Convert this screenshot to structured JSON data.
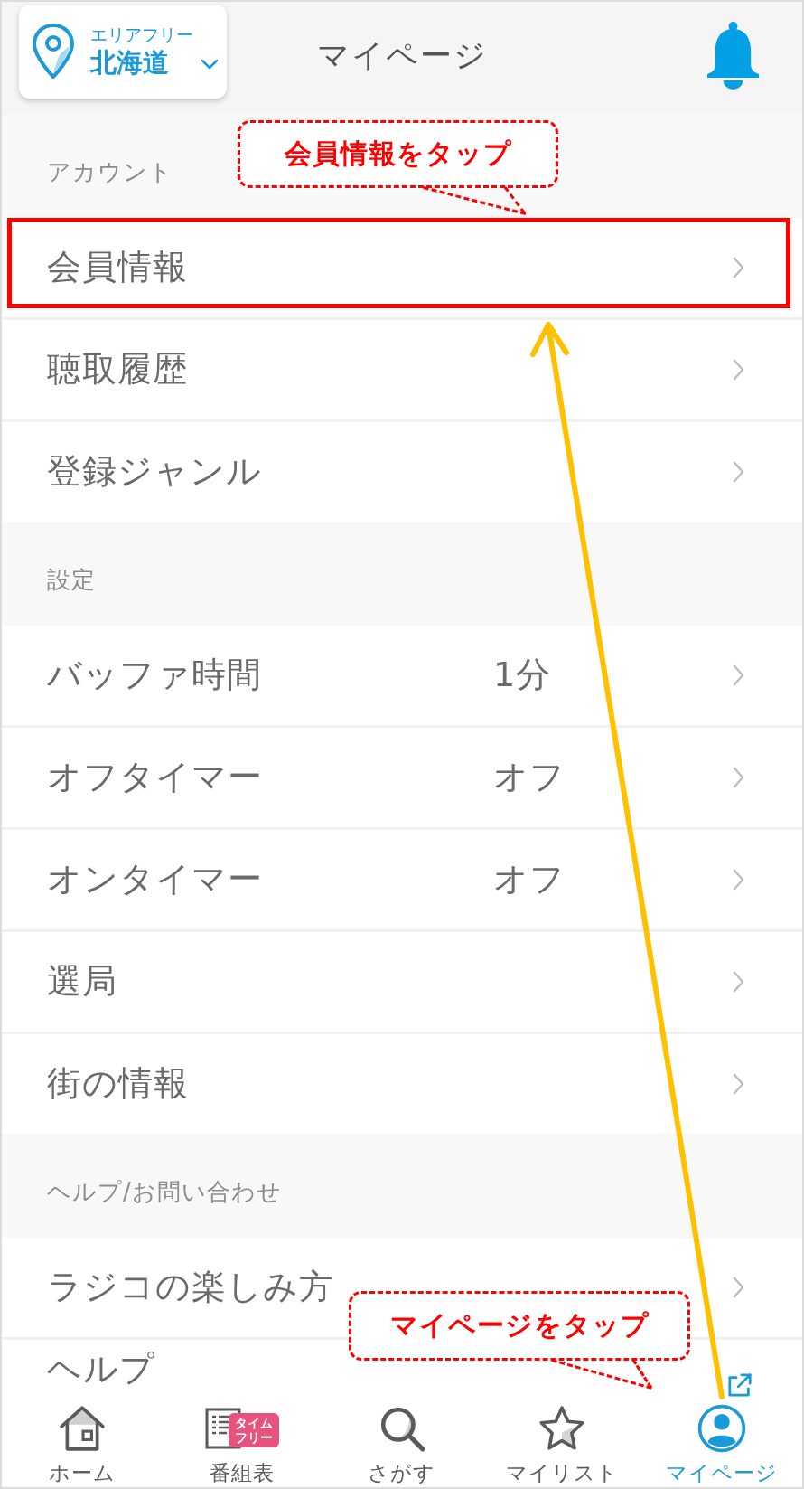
{
  "header": {
    "area_label": "エリアフリー",
    "area": "北海道",
    "title": "マイページ"
  },
  "sections": [
    {
      "title": "アカウント",
      "rows": [
        {
          "kind": "link",
          "label": "会員情報",
          "highlighted": true
        },
        {
          "kind": "link",
          "label": "聴取履歴",
          "highlighted": false
        },
        {
          "kind": "link",
          "label": "登録ジャンル",
          "highlighted": false
        }
      ]
    },
    {
      "title": "設定",
      "rows": [
        {
          "kind": "link",
          "label": "バッファ時間",
          "value": "1分",
          "highlighted": false
        },
        {
          "kind": "link",
          "label": "オフタイマー",
          "value": "オフ",
          "highlighted": false
        },
        {
          "kind": "link",
          "label": "オンタイマー",
          "value": "オフ",
          "highlighted": false
        },
        {
          "kind": "link",
          "label": "選局",
          "highlighted": false
        },
        {
          "kind": "link",
          "label": "街の情報",
          "highlighted": false
        }
      ]
    },
    {
      "title": "ヘルプ/お問い合わせ",
      "rows": [
        {
          "kind": "link",
          "label": "ラジコの楽しみ方",
          "highlighted": false
        },
        {
          "kind": "external",
          "label": "ヘルプ",
          "highlighted": false
        }
      ]
    }
  ],
  "tab_bar": [
    {
      "kind": "home",
      "label": "ホーム",
      "selected": false
    },
    {
      "kind": "guide",
      "label": "番組表",
      "badge": "タイムフリー",
      "selected": false
    },
    {
      "kind": "search",
      "label": "さがす",
      "selected": false
    },
    {
      "kind": "star",
      "label": "マイリスト",
      "selected": false
    },
    {
      "kind": "profile",
      "label": "マイページ",
      "selected": true
    }
  ],
  "annotations": {
    "callouts": [
      {
        "text": "会員情報をタップ"
      },
      {
        "text": "マイページをタップ"
      }
    ],
    "arrow": true
  }
}
